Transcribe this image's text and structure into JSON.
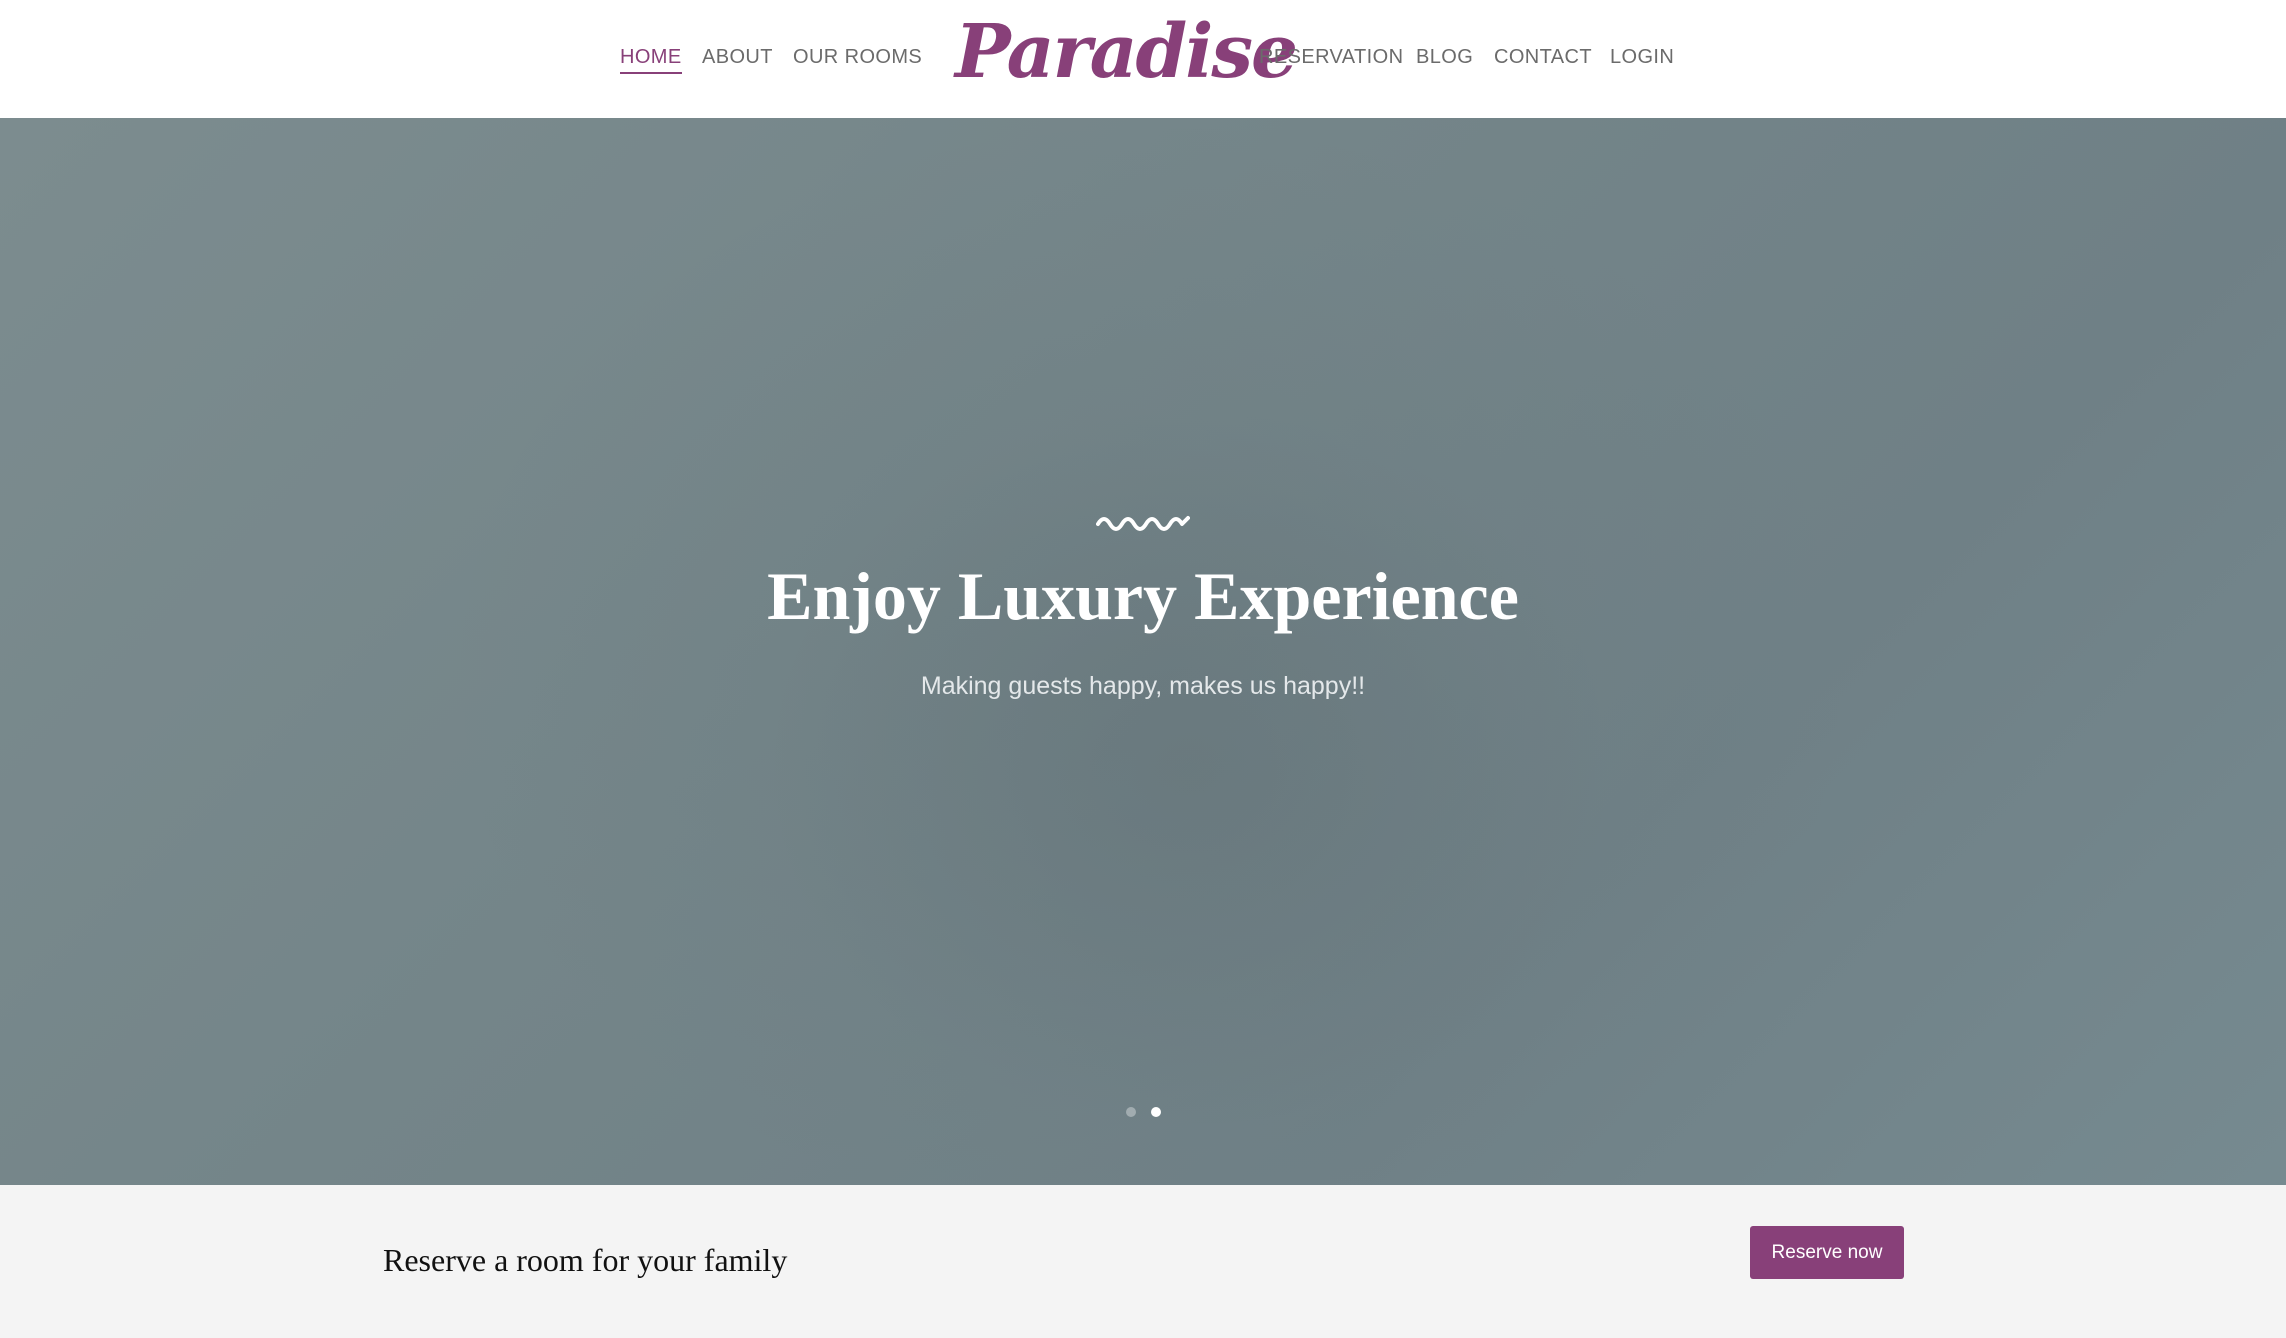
{
  "nav": {
    "home": "HOME",
    "about": "ABOUT",
    "rooms": "OUR ROOMS",
    "reservation": "RESERVATION",
    "blog": "BLOG",
    "contact": "CONTACT",
    "login": "LOGIN",
    "active_item": "HOME"
  },
  "logo": {
    "text": "Paradise"
  },
  "hero": {
    "title": "Enjoy Luxury Experience",
    "subtitle": "Making guests happy, makes us happy!!",
    "slide_count": 2,
    "active_slide": 2
  },
  "reserve": {
    "text": "Reserve a room for your family",
    "button_label": "Reserve now"
  },
  "colors": {
    "brand": "#884079",
    "nav_text": "#6b6b6b",
    "hero_overlay": "#768589",
    "strip_bg": "#f4f4f4"
  },
  "icons": {
    "hero_divider": "wave-divider-icon"
  }
}
